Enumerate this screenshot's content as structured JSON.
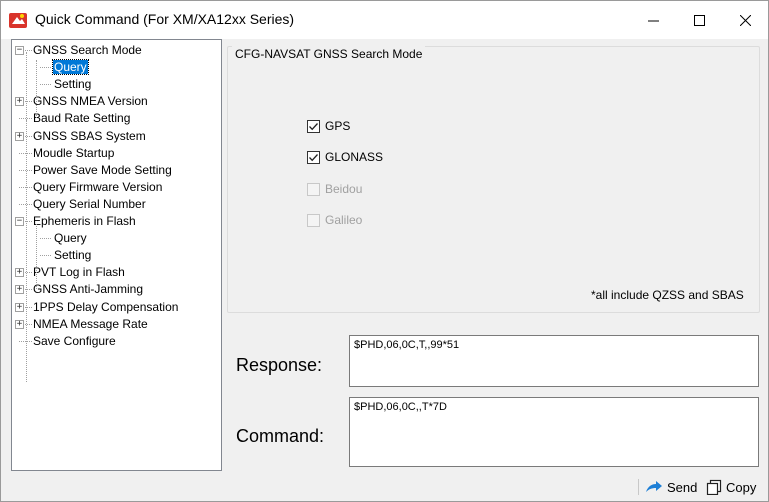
{
  "window": {
    "title": "Quick Command (For XM/XA12xx Series)",
    "minimize_glyph": "—",
    "maximize_glyph": "☐",
    "close_glyph": "✕"
  },
  "tree": {
    "items": [
      {
        "label": "GNSS Search Mode",
        "expander": "−"
      },
      {
        "label": "Query",
        "selected": true
      },
      {
        "label": "Setting"
      },
      {
        "label": "GNSS NMEA Version",
        "expander": "+"
      },
      {
        "label": "Baud Rate Setting"
      },
      {
        "label": "GNSS SBAS System",
        "expander": "+"
      },
      {
        "label": "Moudle Startup"
      },
      {
        "label": "Power Save Mode Setting"
      },
      {
        "label": "Query Firmware Version"
      },
      {
        "label": "Query Serial Number"
      },
      {
        "label": "Ephemeris in Flash",
        "expander": "−"
      },
      {
        "label": "Query"
      },
      {
        "label": "Setting"
      },
      {
        "label": "PVT Log in Flash",
        "expander": "+"
      },
      {
        "label": "GNSS Anti-Jamming",
        "expander": "+"
      },
      {
        "label": "1PPS Delay Compensation",
        "expander": "+"
      },
      {
        "label": "NMEA Message Rate",
        "expander": "+"
      },
      {
        "label": "Save Configure"
      }
    ]
  },
  "group": {
    "title": "CFG-NAVSAT GNSS Search Mode",
    "options": [
      {
        "label": "GPS",
        "checked": true,
        "enabled": true
      },
      {
        "label": "GLONASS",
        "checked": true,
        "enabled": true
      },
      {
        "label": "Beidou",
        "checked": false,
        "enabled": false
      },
      {
        "label": "Galileo",
        "checked": false,
        "enabled": false
      }
    ],
    "note": "*all include QZSS and SBAS"
  },
  "response": {
    "label": "Response:",
    "value": "$PHD,06,0C,T,,99*51"
  },
  "command": {
    "label": "Command:",
    "value": "$PHD,06,0C,,T*7D"
  },
  "statusbar": {
    "send_label": "Send",
    "copy_label": "Copy",
    "send_icon": "send-arrow-icon",
    "copy_icon": "copy-icon"
  },
  "colors": {
    "selection": "#0078d7",
    "accent_icon": "#1e7fd6"
  }
}
